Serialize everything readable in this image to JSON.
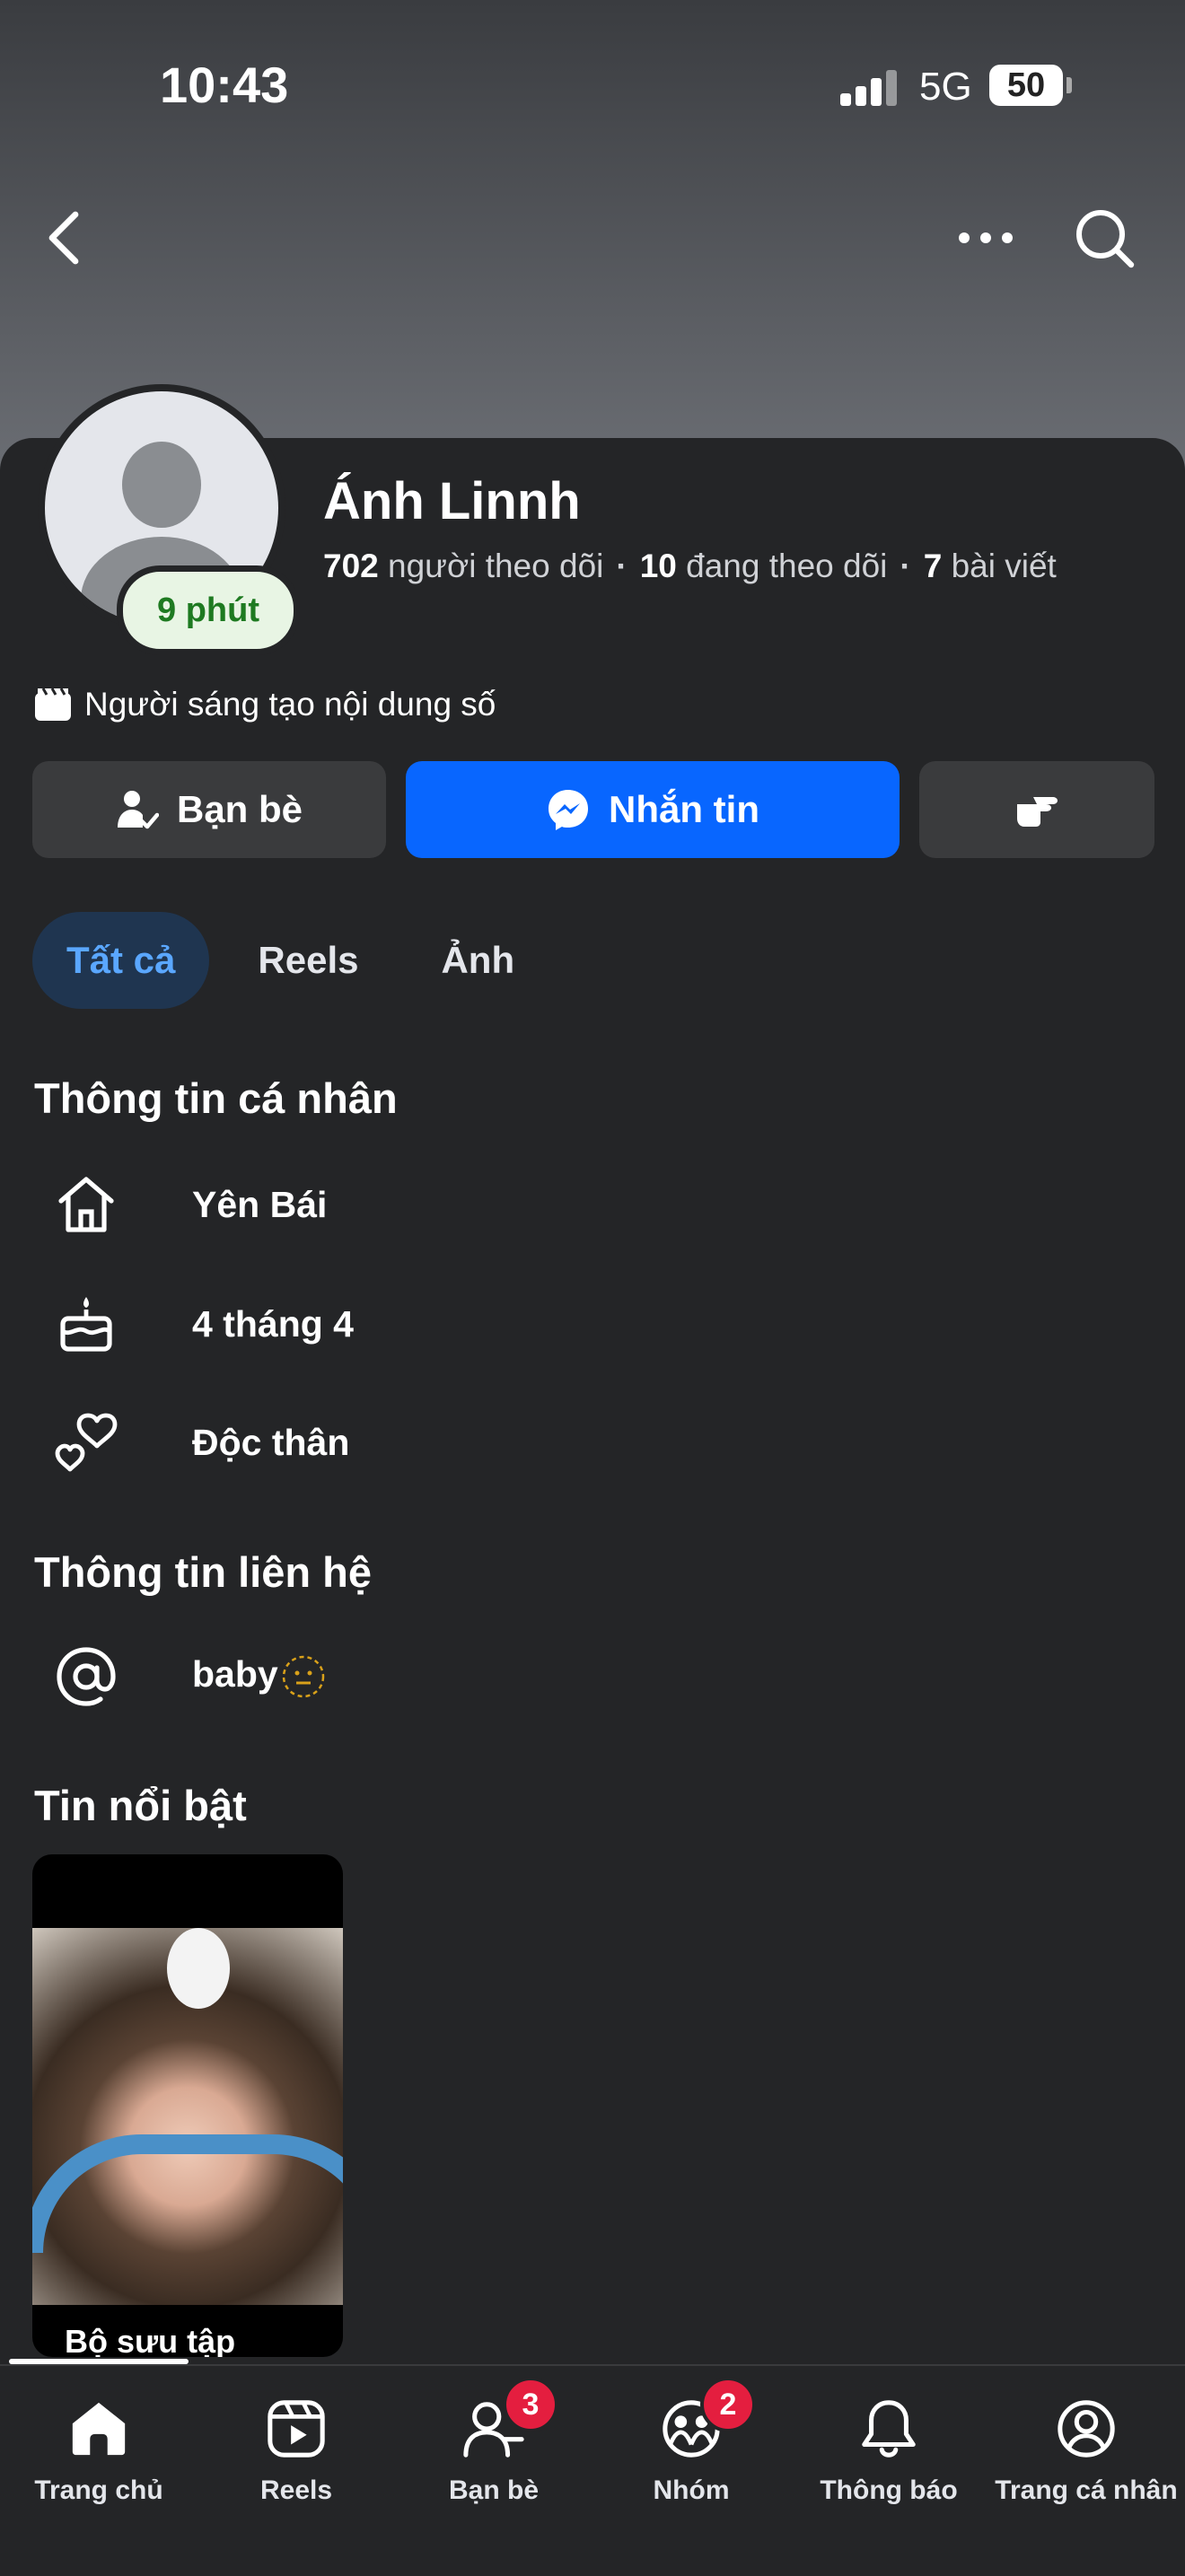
{
  "status_bar": {
    "time": "10:43",
    "network": "5G",
    "battery": "50"
  },
  "profile": {
    "online_badge": "9 phút",
    "name": "Ánh Linnh",
    "followers_count": "702",
    "followers_label": "người theo dõi",
    "following_count": "10",
    "following_label": "đang theo dõi",
    "posts_count": "7",
    "posts_label": "bài viết",
    "category": "Người sáng tạo nội dung số"
  },
  "actions": {
    "friends_label": "Bạn bè",
    "message_label": "Nhắn tin",
    "accent_color": "#0866ff"
  },
  "tabs": [
    {
      "label": "Tất cả",
      "active": true
    },
    {
      "label": "Reels",
      "active": false
    },
    {
      "label": "Ảnh",
      "active": false
    }
  ],
  "personal_info": {
    "title": "Thông tin cá nhân",
    "items": [
      {
        "icon": "home-icon",
        "text": "Yên Bái"
      },
      {
        "icon": "birthday-cake-icon",
        "text": "4 tháng 4"
      },
      {
        "icon": "hearts-icon",
        "text": "Độc thân"
      }
    ]
  },
  "contact_info": {
    "title": "Thông tin liên hệ",
    "items": [
      {
        "icon": "at-sign-icon",
        "text": "baby"
      }
    ]
  },
  "highlights": {
    "title": "Tin nổi bật",
    "items": [
      {
        "label": "Bộ sưu tập"
      }
    ]
  },
  "bottom_nav": [
    {
      "label": "Trang chủ",
      "icon": "home-icon",
      "active": true,
      "badge": ""
    },
    {
      "label": "Reels",
      "icon": "reels-icon",
      "active": false,
      "badge": ""
    },
    {
      "label": "Bạn bè",
      "icon": "friends-icon",
      "active": false,
      "badge": "3"
    },
    {
      "label": "Nhóm",
      "icon": "groups-icon",
      "active": false,
      "badge": "2"
    },
    {
      "label": "Thông báo",
      "icon": "bell-icon",
      "active": false,
      "badge": ""
    },
    {
      "label": "Trang cá nhân",
      "icon": "profile-icon",
      "active": false,
      "badge": ""
    }
  ]
}
